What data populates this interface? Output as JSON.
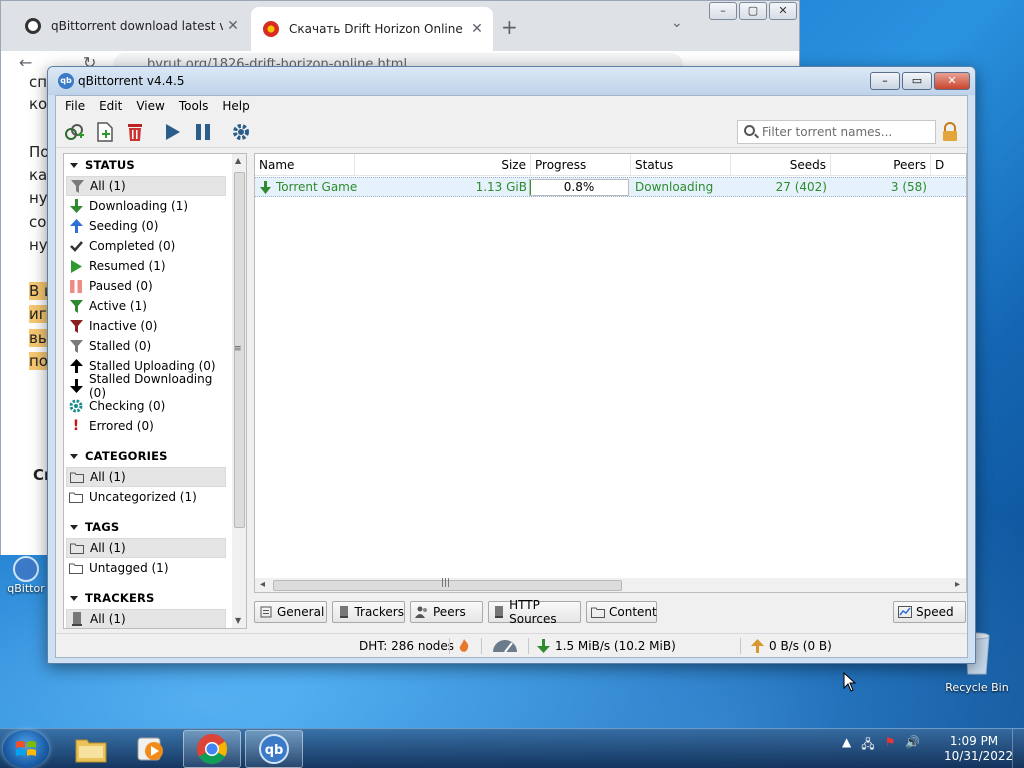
{
  "chrome": {
    "tab1_title": "qBittorrent download latest version",
    "tab2_title": "Скачать Drift Horizon Online (no",
    "url": "byrut.org/1826-drift-horizon-online.html",
    "page_lines": [
      "сп",
      "ко",
      "По",
      "ках",
      "нуж",
      "сос",
      "нуж",
      "В и",
      "игр",
      "вы",
      "под",
      "Cr"
    ]
  },
  "desktop": {
    "qbittorrent_icon_label": "qBittor",
    "recycle_bin_label": "Recycle Bin"
  },
  "window": {
    "title": "qBittorrent v4.4.5"
  },
  "menu": [
    "File",
    "Edit",
    "View",
    "Tools",
    "Help"
  ],
  "toolbar": {
    "search_placeholder": "Filter torrent names..."
  },
  "sidebar": {
    "status_header": "STATUS",
    "status_items": [
      {
        "label": "All (1)",
        "icon": "filter-icon",
        "color": "#7a7a7a"
      },
      {
        "label": "Downloading (1)",
        "icon": "arrow-down-icon",
        "color": "#2e8b2e"
      },
      {
        "label": "Seeding (0)",
        "icon": "arrow-up-icon",
        "color": "#2f6fd6"
      },
      {
        "label": "Completed (0)",
        "icon": "check-icon",
        "color": "#333333"
      },
      {
        "label": "Resumed (1)",
        "icon": "play-icon",
        "color": "#2e9a2e"
      },
      {
        "label": "Paused (0)",
        "icon": "pause-icon",
        "color": "#f08a84"
      },
      {
        "label": "Active (1)",
        "icon": "filter-icon",
        "color": "#2e8b2e"
      },
      {
        "label": "Inactive (0)",
        "icon": "filter-icon",
        "color": "#8b2020"
      },
      {
        "label": "Stalled (0)",
        "icon": "filter-icon",
        "color": "#7a7a7a"
      },
      {
        "label": "Stalled Uploading (0)",
        "icon": "arrow-up-icon",
        "color": "#000000"
      },
      {
        "label": "Stalled Downloading (0)",
        "icon": "arrow-down-icon",
        "color": "#000000"
      },
      {
        "label": "Checking (0)",
        "icon": "gear-icon",
        "color": "#1b8c8c"
      },
      {
        "label": "Errored (0)",
        "icon": "exclamation-icon",
        "color": "#d01010"
      }
    ],
    "categories_header": "CATEGORIES",
    "categories": [
      "All (1)",
      "Uncategorized (1)"
    ],
    "tags_header": "TAGS",
    "tags": [
      "All (1)",
      "Untagged (1)"
    ],
    "trackers_header": "TRACKERS",
    "trackers": [
      "All (1)"
    ]
  },
  "table": {
    "columns": [
      "Name",
      "Size",
      "Progress",
      "Status",
      "Seeds",
      "Peers",
      "D"
    ],
    "rows": [
      {
        "name": "Torrent Game",
        "size": "1.13 GiB",
        "progress_text": "0.8%",
        "progress": 0.008,
        "status": "Downloading",
        "seeds": "27 (402)",
        "peers": "3 (58)"
      }
    ]
  },
  "bottom_tabs": [
    "General",
    "Trackers",
    "Peers",
    "HTTP Sources",
    "Content"
  ],
  "speed_button": "Speed",
  "statusbar": {
    "dht": "DHT: 286 nodes",
    "download": "1.5 MiB/s (10.2 MiB)",
    "upload": "0 B/s (0 B)"
  },
  "taskbar": {
    "time": "1:09 PM",
    "date": "10/31/2022"
  }
}
